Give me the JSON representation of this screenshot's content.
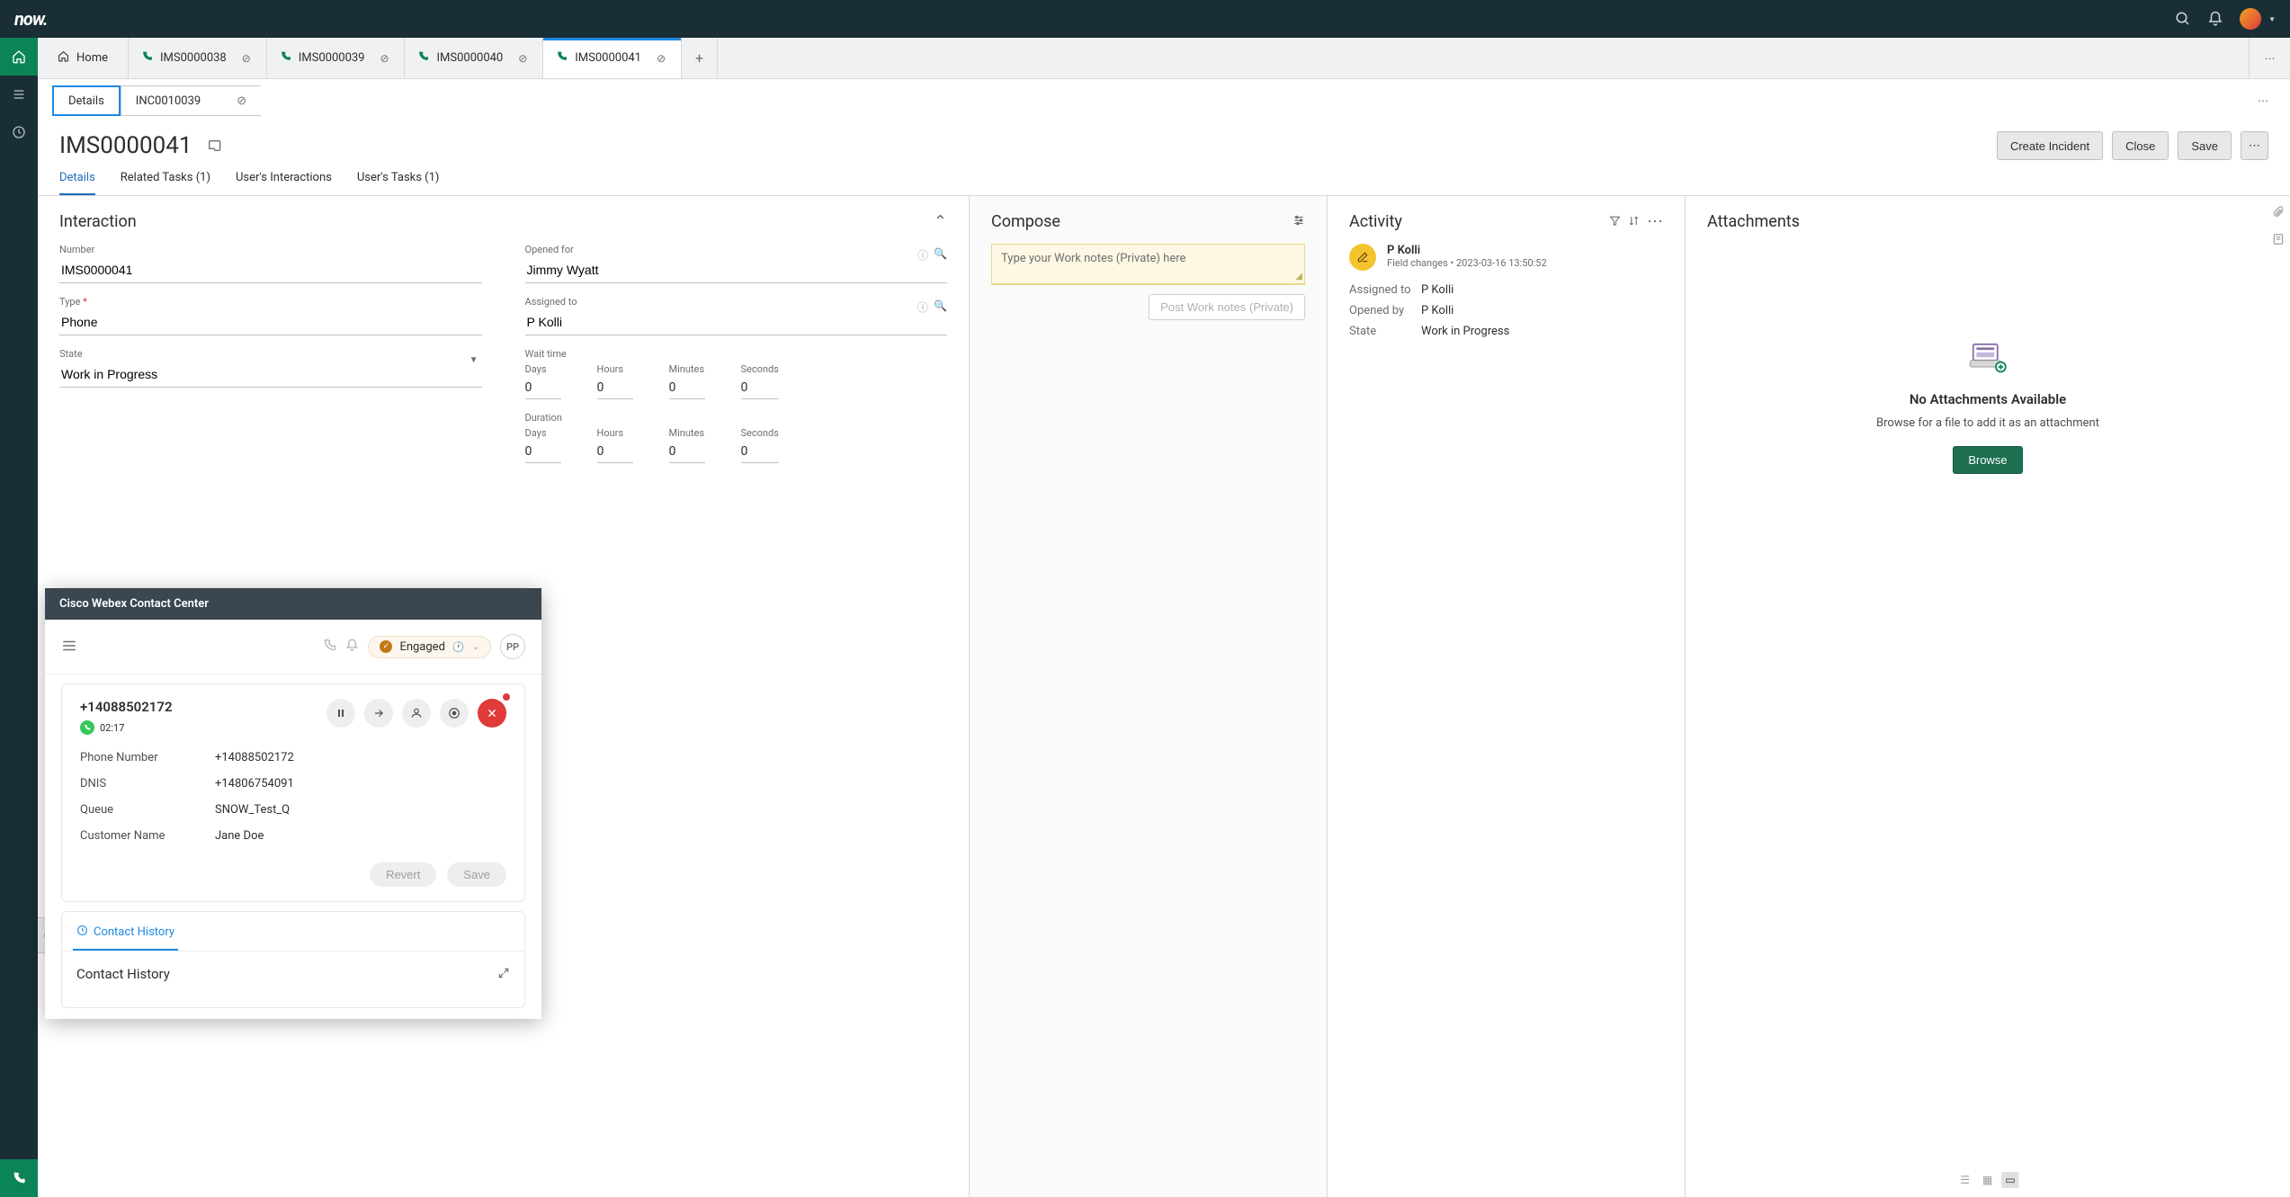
{
  "brand": "now.",
  "leftrail": {
    "home": "home",
    "list": "list",
    "timer": "timer",
    "phone": "phone"
  },
  "tabs": {
    "home": "Home",
    "items": [
      {
        "label": "IMS0000038"
      },
      {
        "label": "IMS0000039"
      },
      {
        "label": "IMS0000040"
      },
      {
        "label": "IMS0000041"
      }
    ],
    "activeIndex": 3
  },
  "subtabs": {
    "details": "Details",
    "inc": "INC0010039"
  },
  "record": {
    "title": "IMS0000041",
    "actions": {
      "create": "Create Incident",
      "close": "Close",
      "save": "Save"
    },
    "tabs": {
      "details": "Details",
      "related": "Related Tasks (1)",
      "userInteractions": "User's Interactions",
      "userTasks": "User's Tasks (1)"
    }
  },
  "interaction": {
    "title": "Interaction",
    "number_label": "Number",
    "number": "IMS0000041",
    "type_label": "Type",
    "type_req": "*",
    "type": "Phone",
    "state_label": "State",
    "state": "Work in Progress",
    "opened_for_label": "Opened for",
    "opened_for": "Jimmy Wyatt",
    "assigned_to_label": "Assigned to",
    "assigned_to": "P Kolli",
    "wait_label": "Wait time",
    "duration_label": "Duration",
    "units": {
      "days": "Days",
      "hours": "Hours",
      "minutes": "Minutes",
      "seconds": "Seconds"
    },
    "wait": {
      "days": "0",
      "hours": "0",
      "minutes": "0",
      "seconds": "0"
    },
    "duration": {
      "days": "0",
      "hours": "0",
      "minutes": "0",
      "seconds": "0"
    }
  },
  "compose": {
    "title": "Compose",
    "placeholder": "Type your Work notes (Private) here",
    "post": "Post Work notes (Private)"
  },
  "activity": {
    "title": "Activity",
    "entry": {
      "name": "P Kolli",
      "sub_prefix": "Field changes",
      "sub_sep": "•",
      "timestamp": "2023-03-16 13:50:52",
      "fields": {
        "assigned_to_k": "Assigned to",
        "assigned_to_v": "P Kolli",
        "opened_by_k": "Opened by",
        "opened_by_v": "P Kolli",
        "state_k": "State",
        "state_v": "Work in Progress"
      }
    }
  },
  "attachments": {
    "title": "Attachments",
    "empty_h": "No Attachments Available",
    "empty_sub": "Browse for a file to add it as an attachment",
    "browse": "Browse"
  },
  "webex": {
    "title": "Cisco Webex Contact Center",
    "status": "Engaged",
    "avatar": "PP",
    "phone": "+14088502172",
    "timer": "02:17",
    "kv": {
      "phone_k": "Phone Number",
      "phone_v": "+14088502172",
      "dnis_k": "DNIS",
      "dnis_v": "+14806754091",
      "queue_k": "Queue",
      "queue_v": "SNOW_Test_Q",
      "cust_k": "Customer Name",
      "cust_v": "Jane Doe"
    },
    "revert": "Revert",
    "save": "Save",
    "contact_history_tab": "Contact History",
    "contact_history_title": "Contact History"
  }
}
